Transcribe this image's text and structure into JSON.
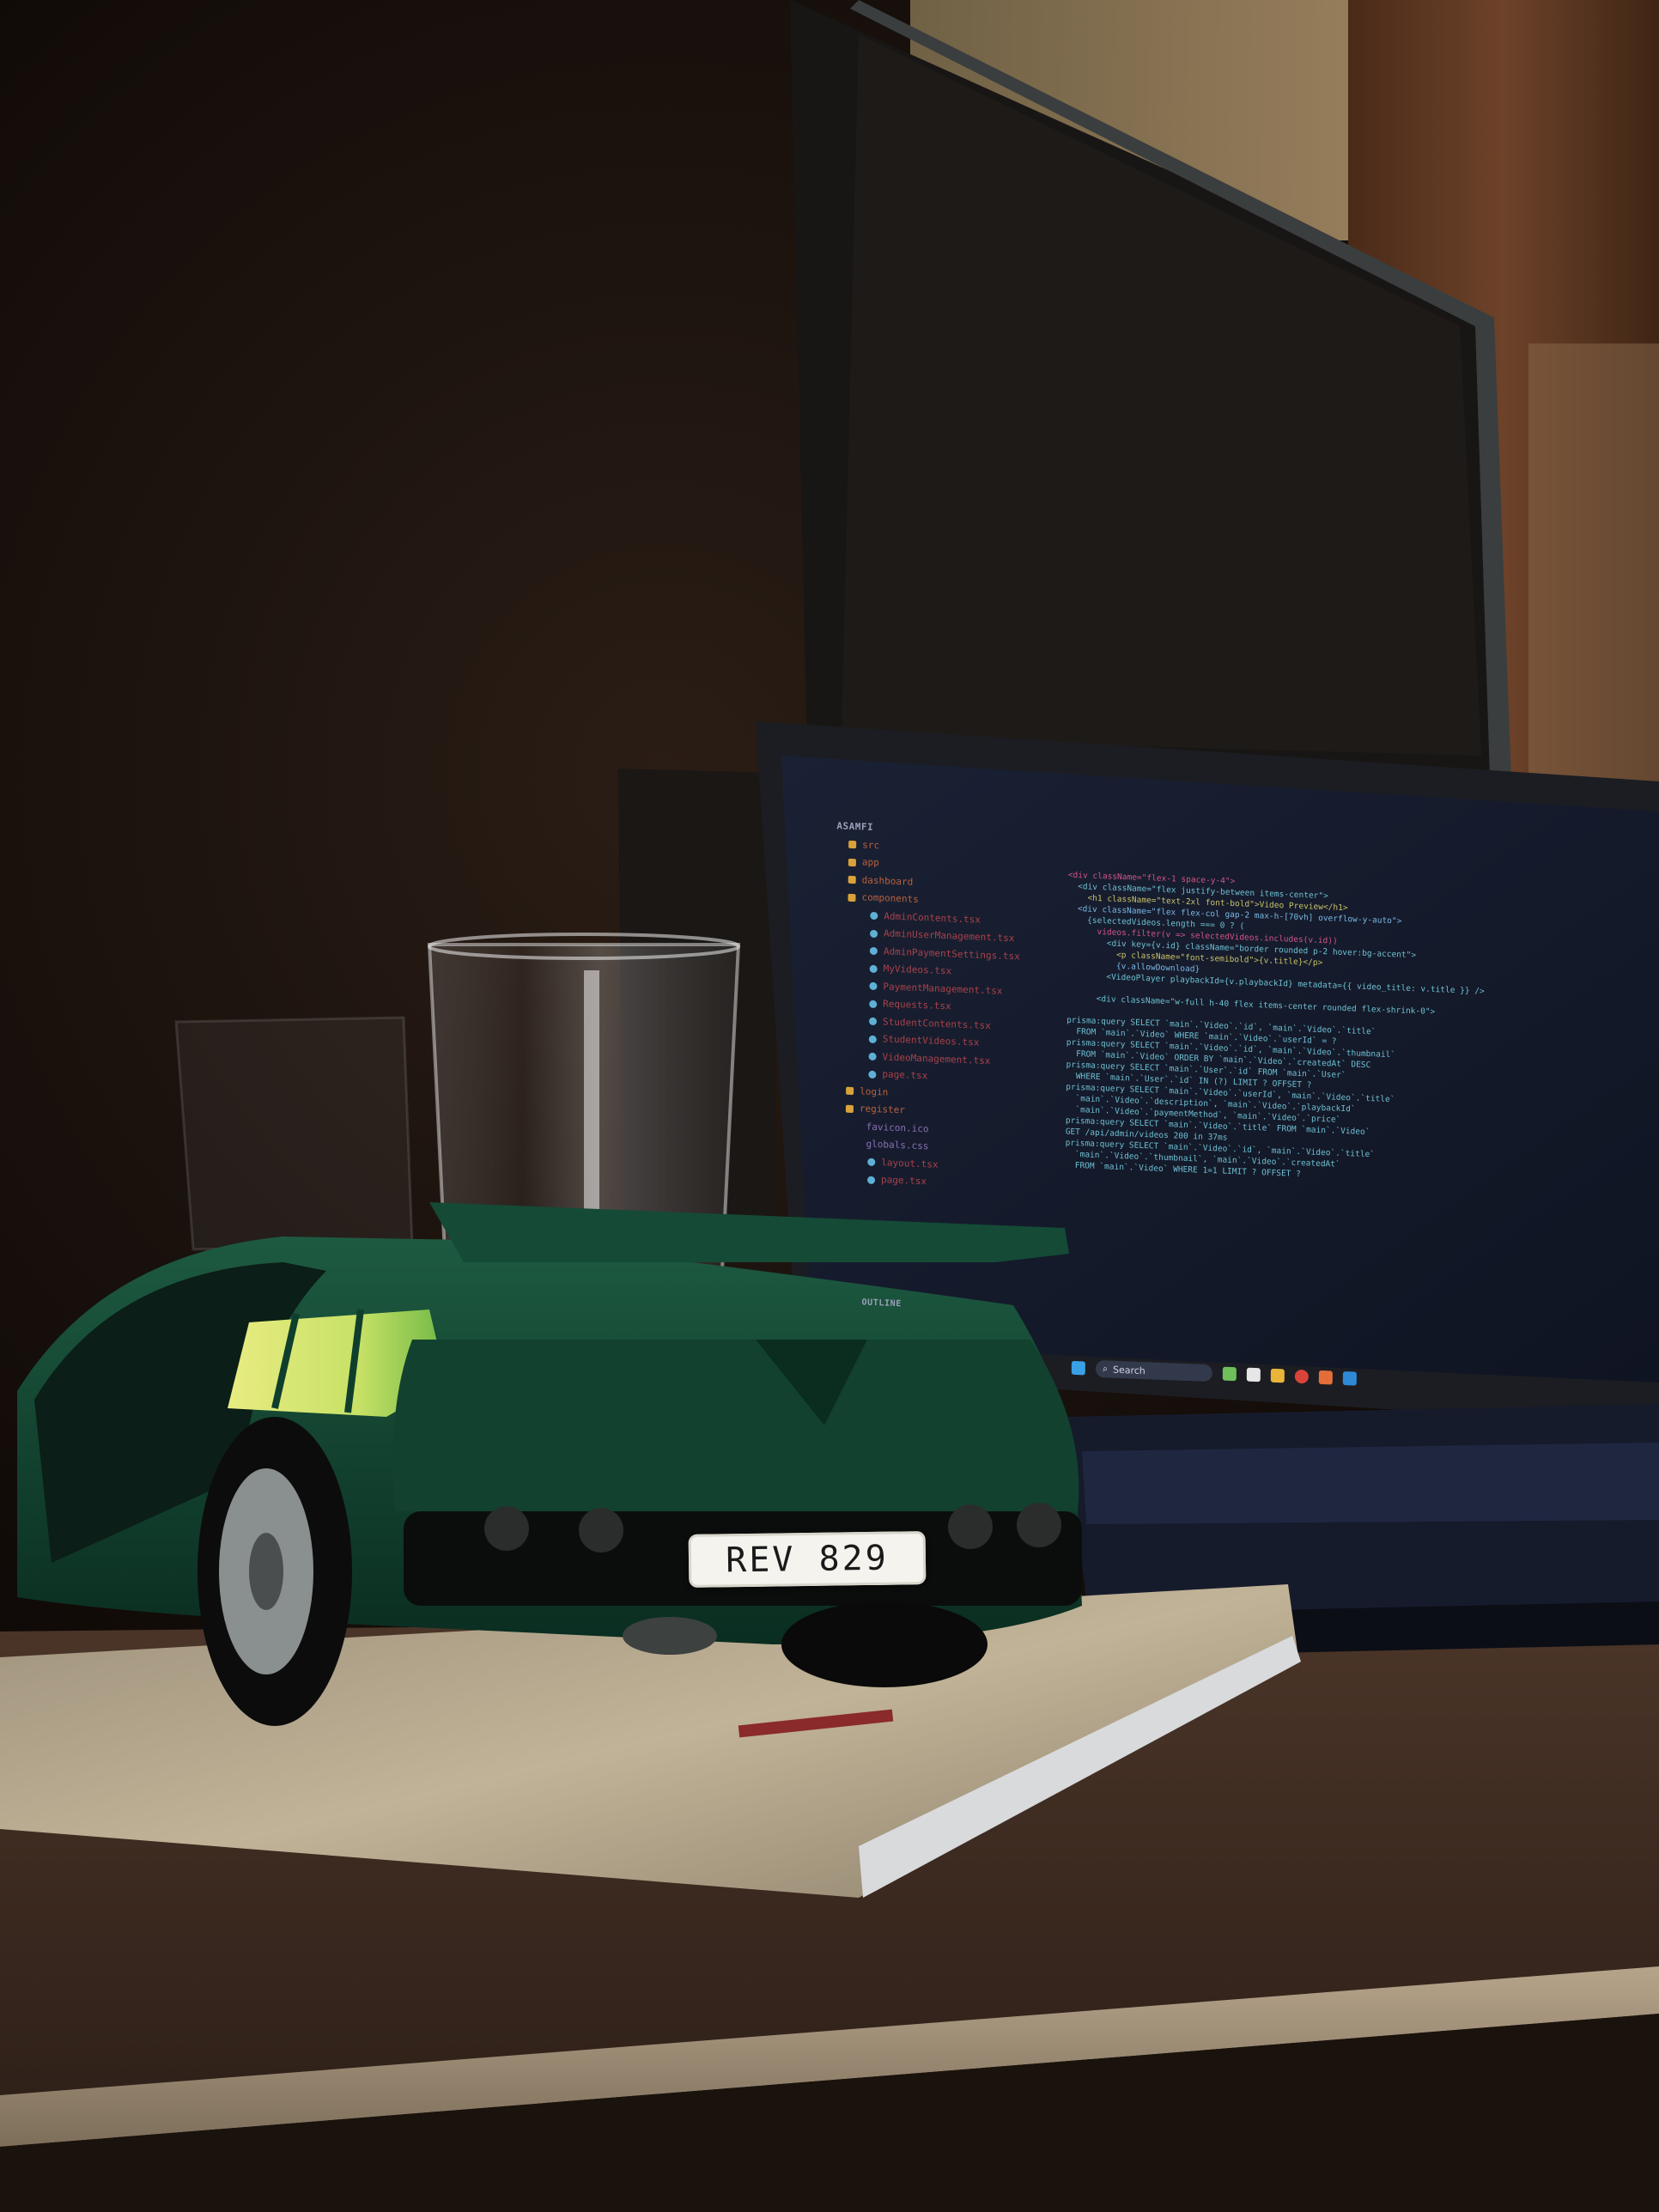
{
  "ide": {
    "explorer": [
      {
        "label": "ASAMFI",
        "kind": "root"
      },
      {
        "label": "src",
        "kind": "dir"
      },
      {
        "label": "app",
        "kind": "dir"
      },
      {
        "label": "dashboard",
        "kind": "dir"
      },
      {
        "label": "components",
        "kind": "dir"
      },
      {
        "label": "AdminContents.tsx",
        "kind": "file"
      },
      {
        "label": "AdminUserManagement.tsx",
        "kind": "file"
      },
      {
        "label": "AdminPaymentSettings.tsx",
        "kind": "file"
      },
      {
        "label": "MyVideos.tsx",
        "kind": "file"
      },
      {
        "label": "PaymentManagement.tsx",
        "kind": "file"
      },
      {
        "label": "Requests.tsx",
        "kind": "file"
      },
      {
        "label": "StudentContents.tsx",
        "kind": "file"
      },
      {
        "label": "StudentVideos.tsx",
        "kind": "file"
      },
      {
        "label": "VideoManagement.tsx",
        "kind": "file"
      },
      {
        "label": "page.tsx",
        "kind": "file"
      },
      {
        "label": "login",
        "kind": "dir"
      },
      {
        "label": "register",
        "kind": "dir"
      },
      {
        "label": "favicon.ico",
        "kind": "other"
      },
      {
        "label": "globals.css",
        "kind": "other"
      },
      {
        "label": "layout.tsx",
        "kind": "file"
      },
      {
        "label": "page.tsx",
        "kind": "file"
      }
    ],
    "outline_label": "OUTLINE",
    "code_lines": [
      "<div className=\"flex-1 space-y-4\">",
      "  <div className=\"flex justify-between items-center\">",
      "    <h1 className=\"text-2xl font-bold\">Video Preview</h1>",
      "  <div className=\"flex flex-col gap-2 max-h-[70vh] overflow-y-auto\">",
      "    {selectedVideos.length === 0 ? (",
      "      videos.filter(v => selectedVideos.includes(v.id))",
      "        <div key={v.id} className=\"border rounded p-2 hover:bg-accent\">",
      "          <p className=\"font-semibold\">{v.title}</p>",
      "          {v.allowDownload}",
      "        <VideoPlayer playbackId={v.playbackId} metadata={{ video_title: v.title }} />",
      "",
      "      <div className=\"w-full h-40 flex items-center rounded flex-shrink-0\">",
      "",
      "prisma:query SELECT `main`.`Video`.`id`, `main`.`Video`.`title`",
      "  FROM `main`.`Video` WHERE `main`.`Video`.`userId` = ?",
      "prisma:query SELECT `main`.`Video`.`id`, `main`.`Video`.`thumbnail`",
      "  FROM `main`.`Video` ORDER BY `main`.`Video`.`createdAt` DESC",
      "prisma:query SELECT `main`.`User`.`id` FROM `main`.`User`",
      "  WHERE `main`.`User`.`id` IN (?) LIMIT ? OFFSET ?",
      "prisma:query SELECT `main`.`Video`.`userId`, `main`.`Video`.`title`",
      "  `main`.`Video`.`description`, `main`.`Video`.`playbackId`",
      "  `main`.`Video`.`paymentMethod`, `main`.`Video`.`price`",
      "prisma:query SELECT `main`.`Video`.`title` FROM `main`.`Video`",
      "GET /api/admin/videos 200 in 37ms",
      "prisma:query SELECT `main`.`Video`.`id`, `main`.`Video`.`title`",
      "  `main`.`Video`.`thumbnail`, `main`.`Video`.`createdAt`",
      "  FROM `main`.`Video` WHERE 1=1 LIMIT ? OFFSET ?"
    ],
    "taskbar": {
      "search_label": "Search"
    }
  },
  "car": {
    "plate": "REV 829"
  },
  "colors": {
    "wall": "#1b120c",
    "monitor_bezel": "#2a2d2e",
    "laptop_screen": "#14192a",
    "code_text": "#6ec0d2",
    "desk": "#3b2b22",
    "car_body": "#0f3f2c",
    "car_stripe_yellow": "#e3e874",
    "car_stripe_green": "#7fc04a",
    "notebook": "#b8ab90"
  }
}
